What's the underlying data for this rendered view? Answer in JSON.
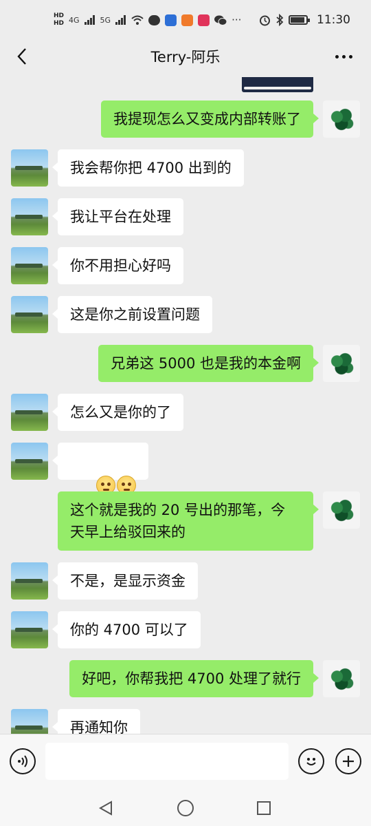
{
  "status_bar": {
    "network_4g": "4G",
    "network_5g": "5G",
    "hd1": "HD",
    "hd2": "HD",
    "more": "···",
    "time": "11:30"
  },
  "nav": {
    "title": "Terry-阿乐"
  },
  "messages": [
    {
      "side": "self",
      "text": "我提现怎么又变成内部转账了"
    },
    {
      "side": "other",
      "text": "我会帮你把 4700 出到的"
    },
    {
      "side": "other",
      "text": "我让平台在处理"
    },
    {
      "side": "other",
      "text": "你不用担心好吗"
    },
    {
      "side": "other",
      "text": "这是你之前设置问题"
    },
    {
      "side": "self",
      "text": "兄弟这 5000 也是我的本金啊"
    },
    {
      "side": "other",
      "text": "怎么又是你的了"
    },
    {
      "side": "other",
      "text": "",
      "emoji": [
        "flushed-face-emoji",
        "flushed-face-emoji"
      ]
    },
    {
      "side": "self",
      "text": "这个就是我的 20 号出的那笔，今\n天早上给驳回来的"
    },
    {
      "side": "other",
      "text": "不是，是显示资金"
    },
    {
      "side": "other",
      "text": "你的 4700 可以了"
    },
    {
      "side": "self",
      "text": "好吧，你帮我把 4700 处理了就行"
    },
    {
      "side": "other",
      "text": "再通知你"
    }
  ],
  "input": {
    "value": ""
  },
  "colors": {
    "background": "#ededed",
    "self_bubble": "#95ec69",
    "other_bubble": "#ffffff"
  },
  "icons": {
    "back": "chevron-left-icon",
    "more": "more-icon",
    "voice": "voice-icon",
    "emoji": "emoji-icon",
    "plus": "plus-icon"
  }
}
